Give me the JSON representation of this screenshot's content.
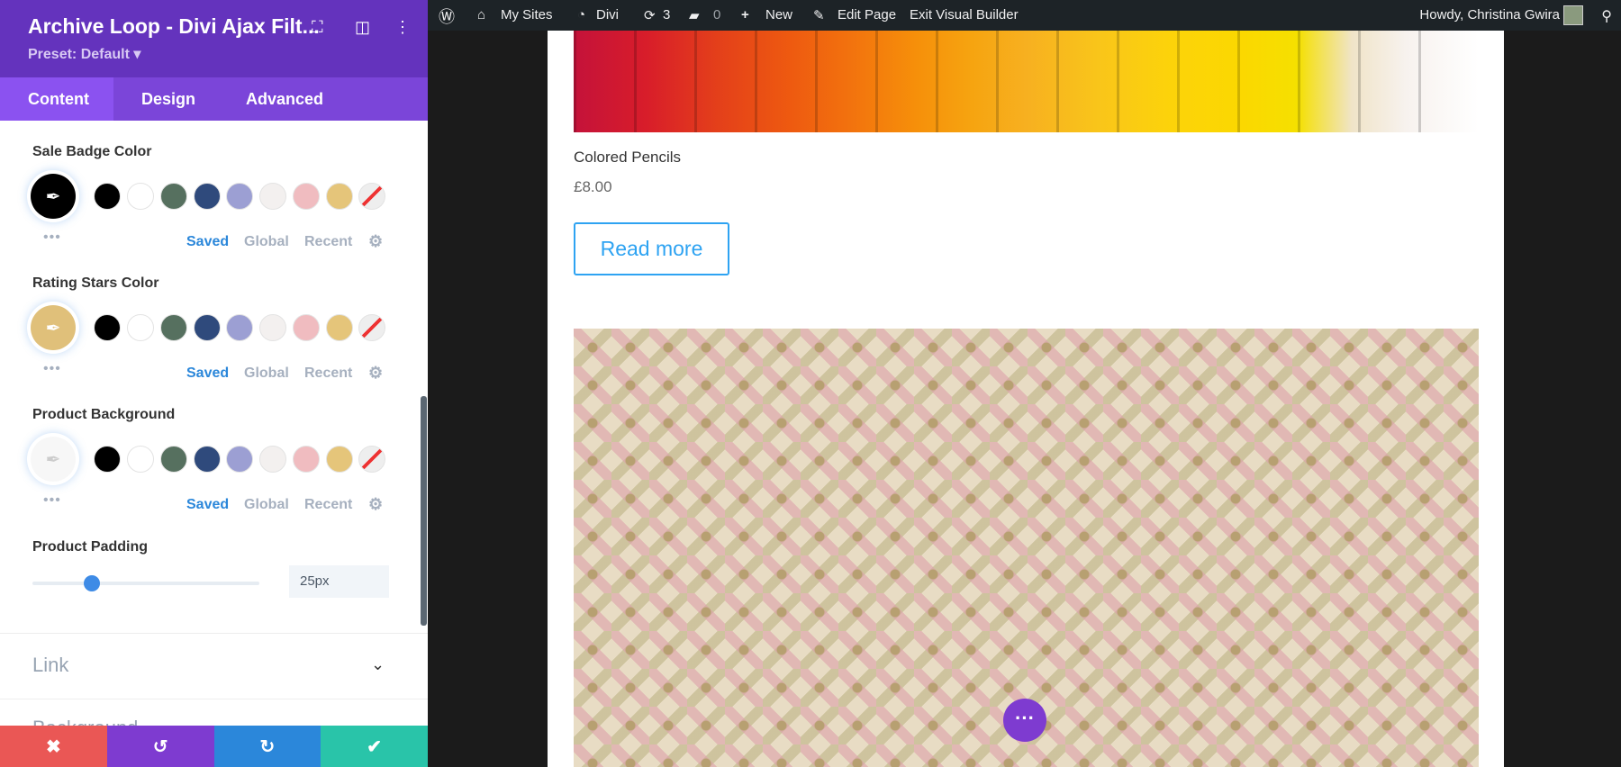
{
  "panel": {
    "title": "Archive Loop - Divi Ajax Filt...",
    "preset": "Preset: Default ▾",
    "tabs": [
      {
        "label": "Content"
      },
      {
        "label": "Design"
      },
      {
        "label": "Advanced"
      }
    ],
    "palette": [
      "#000000",
      "#ffffff",
      "#56705f",
      "#2f4a7c",
      "#9c9fd3",
      "#f3f0ef",
      "#f0bcc0",
      "#e5c57a"
    ],
    "sections": [
      {
        "label": "Sale Badge Color",
        "current": "#000000"
      },
      {
        "label": "Rating Stars Color",
        "current": "#e0c07a"
      },
      {
        "label": "Product Background",
        "current": "#f7f7f7"
      }
    ],
    "palette_tabs": {
      "saved": "Saved",
      "global": "Global",
      "recent": "Recent"
    },
    "padding": {
      "label": "Product Padding",
      "value": "25px",
      "percent": 26
    },
    "link": "Link",
    "background": "Background"
  },
  "adminbar": {
    "my_sites": "My Sites",
    "divi": "Divi",
    "updates": "3",
    "comments": "0",
    "new": "New",
    "edit_page": "Edit Page",
    "exit": "Exit Visual Builder",
    "howdy": "Howdy, Christina Gwira"
  },
  "product": {
    "name": "Colored Pencils",
    "price": "£8.00",
    "button": "Read more"
  }
}
